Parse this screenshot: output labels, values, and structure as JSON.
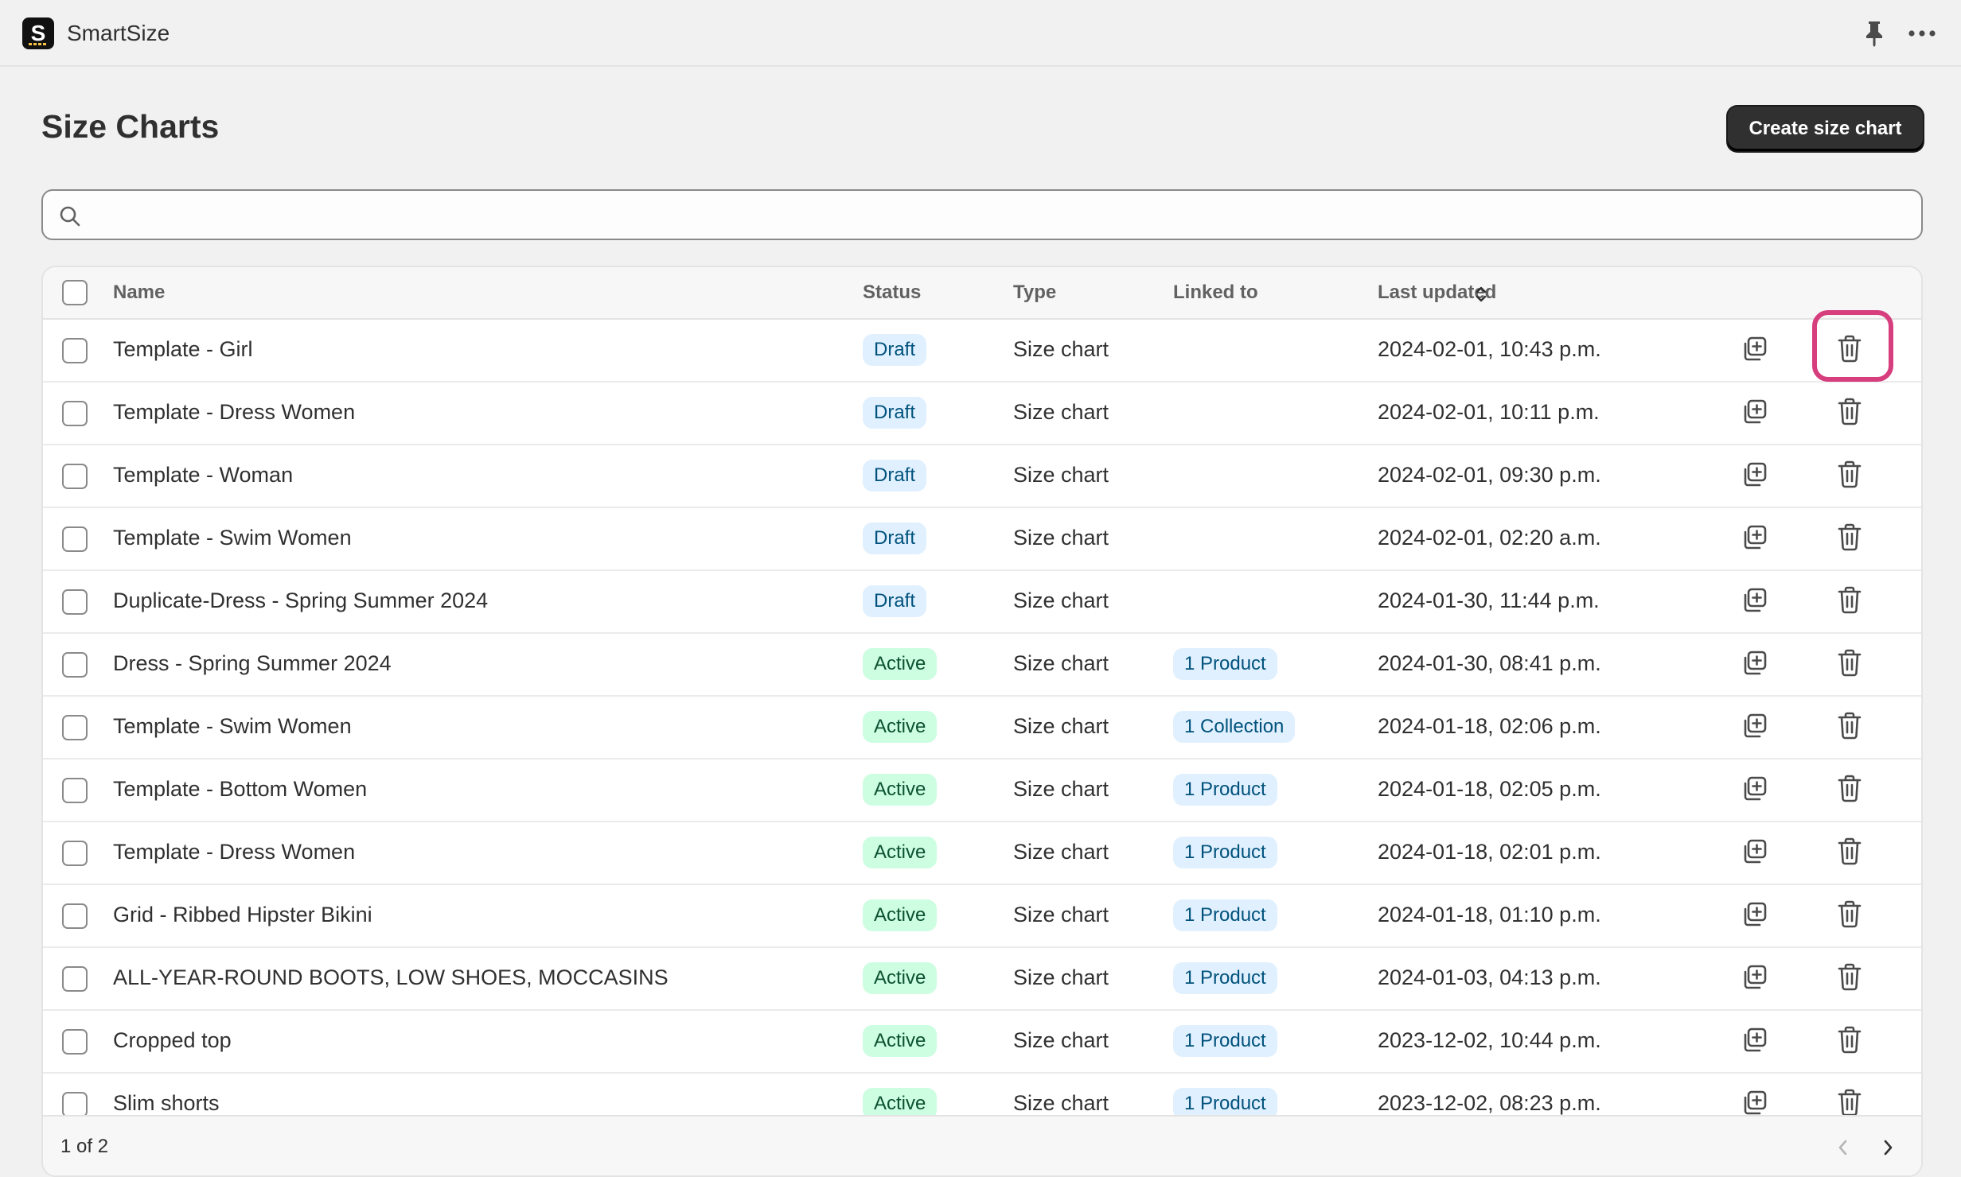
{
  "app": {
    "logo_letter": "S",
    "title": "SmartSize"
  },
  "page": {
    "title": "Size Charts",
    "create_button": "Create size chart"
  },
  "search": {
    "value": "",
    "placeholder": ""
  },
  "table": {
    "headers": {
      "name": "Name",
      "status": "Status",
      "type": "Type",
      "linked_to": "Linked to",
      "last_updated": "Last updated"
    },
    "rows": [
      {
        "name": "Template - Girl",
        "status": "Draft",
        "type": "Size chart",
        "linked": "",
        "updated": "2024-02-01, 10:43 p.m."
      },
      {
        "name": "Template - Dress Women",
        "status": "Draft",
        "type": "Size chart",
        "linked": "",
        "updated": "2024-02-01, 10:11 p.m."
      },
      {
        "name": "Template - Woman",
        "status": "Draft",
        "type": "Size chart",
        "linked": "",
        "updated": "2024-02-01, 09:30 p.m."
      },
      {
        "name": "Template - Swim Women",
        "status": "Draft",
        "type": "Size chart",
        "linked": "",
        "updated": "2024-02-01, 02:20 a.m."
      },
      {
        "name": "Duplicate-Dress - Spring Summer 2024",
        "status": "Draft",
        "type": "Size chart",
        "linked": "",
        "updated": "2024-01-30, 11:44 p.m."
      },
      {
        "name": "Dress - Spring Summer 2024",
        "status": "Active",
        "type": "Size chart",
        "linked": "1 Product",
        "updated": "2024-01-30, 08:41 p.m."
      },
      {
        "name": "Template - Swim Women",
        "status": "Active",
        "type": "Size chart",
        "linked": "1 Collection",
        "updated": "2024-01-18, 02:06 p.m."
      },
      {
        "name": "Template - Bottom Women",
        "status": "Active",
        "type": "Size chart",
        "linked": "1 Product",
        "updated": "2024-01-18, 02:05 p.m."
      },
      {
        "name": "Template - Dress Women",
        "status": "Active",
        "type": "Size chart",
        "linked": "1 Product",
        "updated": "2024-01-18, 02:01 p.m."
      },
      {
        "name": "Grid - Ribbed Hipster Bikini",
        "status": "Active",
        "type": "Size chart",
        "linked": "1 Product",
        "updated": "2024-01-18, 01:10 p.m."
      },
      {
        "name": "ALL-YEAR-ROUND BOOTS, LOW SHOES, MOCCASINS",
        "status": "Active",
        "type": "Size chart",
        "linked": "1 Product",
        "updated": "2024-01-03, 04:13 p.m."
      },
      {
        "name": "Cropped top",
        "status": "Active",
        "type": "Size chart",
        "linked": "1 Product",
        "updated": "2023-12-02, 10:44 p.m."
      },
      {
        "name": "Slim shorts",
        "status": "Active",
        "type": "Size chart",
        "linked": "1 Product",
        "updated": "2023-12-02, 08:23 p.m."
      }
    ],
    "highlighted_row": 0
  },
  "pagination": {
    "label": "1 of 2"
  },
  "colors": {
    "draft_badge": "#e0f0ff",
    "active_badge": "#cdfee1",
    "highlight": "#d63e7e",
    "primary_button": "#303030"
  }
}
